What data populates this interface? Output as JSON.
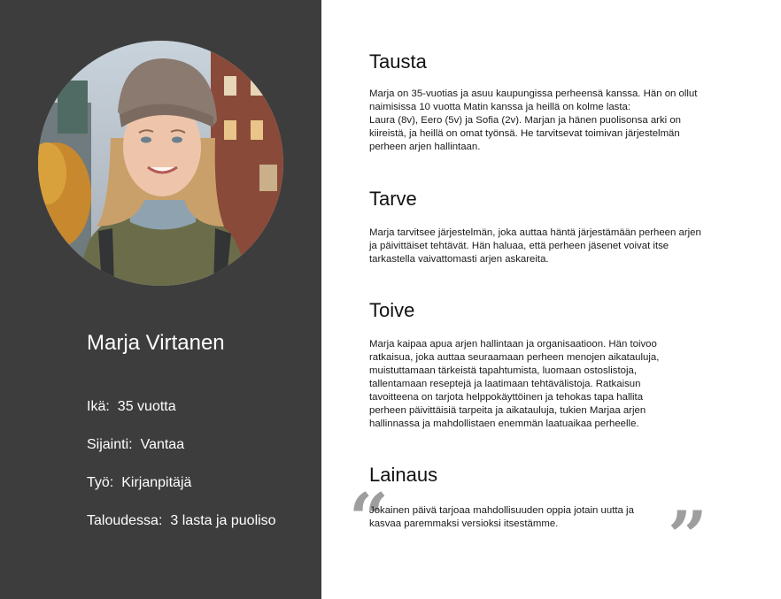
{
  "profile": {
    "name": "Marja Virtanen",
    "facts": [
      {
        "label": "Ikä:",
        "value": "35 vuotta"
      },
      {
        "label": "Sijainti:",
        "value": "Vantaa"
      },
      {
        "label": "Työ:",
        "value": "Kirjanpitäjä"
      },
      {
        "label": "Taloudessa:",
        "value": "3 lasta ja puoliso"
      }
    ]
  },
  "sections": [
    {
      "heading": "Tausta",
      "lines": [
        "Marja on 35-vuotias ja asuu kaupungissa perheensä kanssa. Hän on ollut",
        "naimisissa 10 vuotta Matin kanssa ja heillä on kolme lasta:",
        "Laura (8v), Eero (5v) ja Sofia (2v). Marjan ja hänen puolisonsa arki on",
        "kiireistä, ja heillä on omat työnsä. He tarvitsevat toimivan järjestelmän",
        "perheen arjen hallintaan."
      ]
    },
    {
      "heading": "Tarve",
      "lines": [
        "Marja tarvitsee järjestelmän, joka auttaa häntä järjestämään perheen arjen",
        "ja päivittäiset tehtävät. Hän haluaa, että perheen jäsenet voivat itse",
        "tarkastella vaivattomasti arjen askareita."
      ]
    },
    {
      "heading": "Toive",
      "lines": [
        "Marja kaipaa apua arjen hallintaan ja organisaatioon. Hän toivoo",
        "ratkaisua, joka auttaa seuraamaan perheen menojen aikatauluja,",
        "muistuttamaan tärkeistä tapahtumista, luomaan ostoslistoja,",
        "tallentamaan reseptejä ja laatimaan tehtävälistoja. Ratkaisun",
        "tavoitteena on tarjota helppokäyttöinen ja tehokas tapa hallita",
        "perheen päivittäisiä tarpeita ja aikatauluja, tukien Marjaa arjen",
        "hallinnassa ja mahdollistaen enemmän laatuaikaa perheelle."
      ]
    },
    {
      "heading": "Lainaus",
      "lines": [
        "Jokainen päivä tarjoaa mahdollisuuden oppia jotain uutta ja",
        "kasvaa paremmaksi versioksi itsestämme."
      ]
    }
  ],
  "quote_marks": {
    "open": "“",
    "close": "”"
  },
  "colors": {
    "sidebar": "#3d3d3d",
    "quote_mark": "#9e9e9e",
    "text": "#1a1a1a"
  }
}
